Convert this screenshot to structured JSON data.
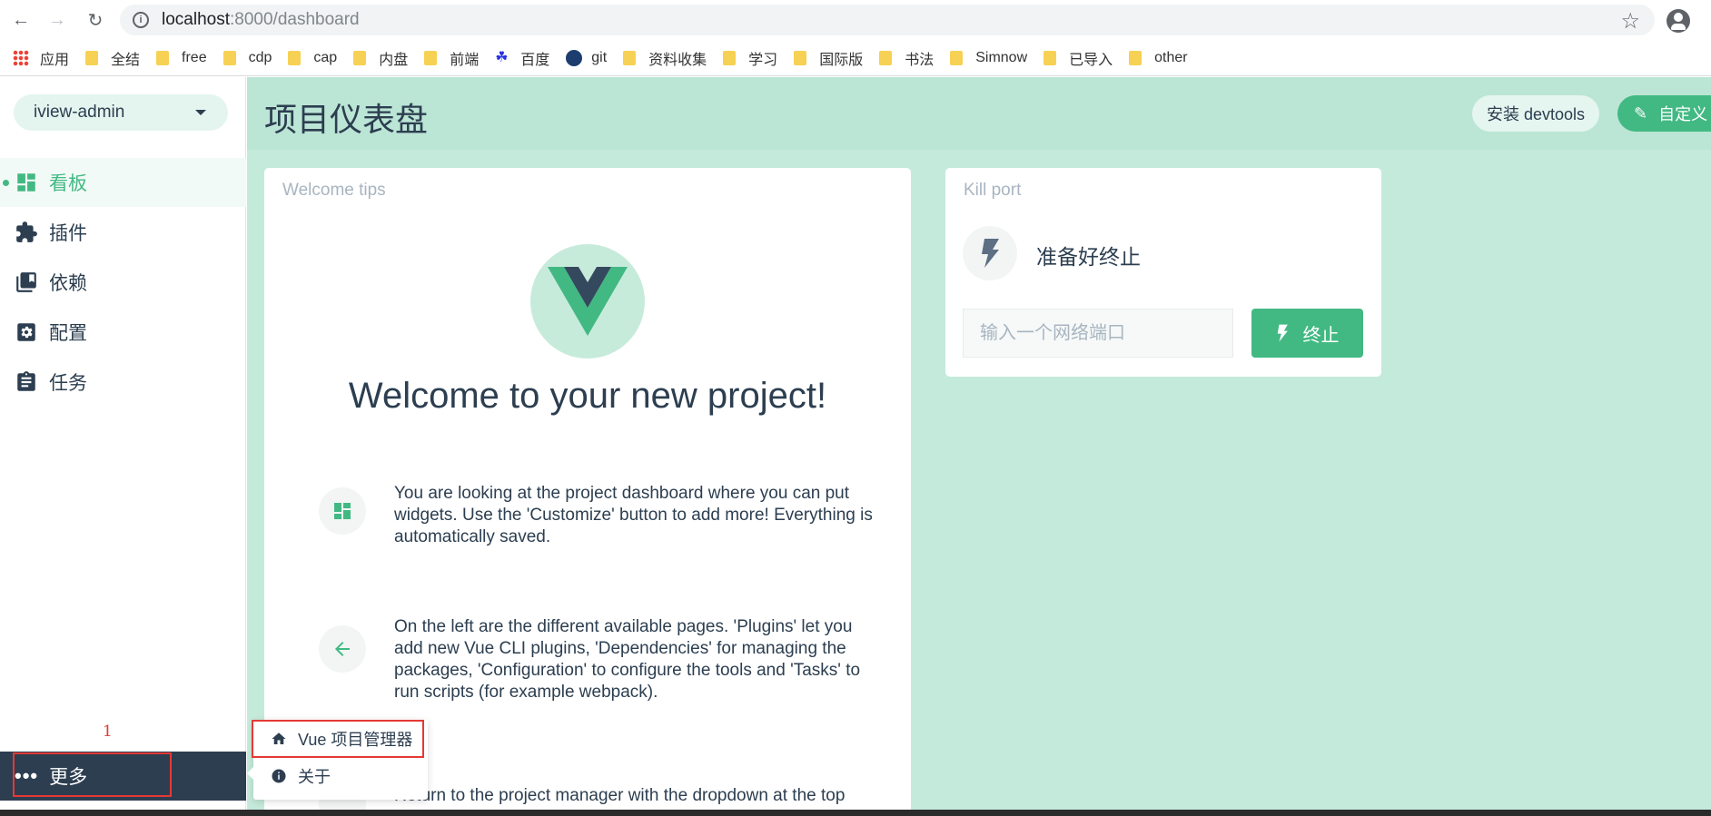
{
  "browser": {
    "url_host": "localhost",
    "url_path": ":8000/dashboard",
    "bookmarks": [
      {
        "label": "应用",
        "kind": "apps"
      },
      {
        "label": "全结",
        "kind": "folder"
      },
      {
        "label": "free",
        "kind": "folder"
      },
      {
        "label": "cdp",
        "kind": "folder"
      },
      {
        "label": "cap",
        "kind": "folder"
      },
      {
        "label": "内盘",
        "kind": "folder"
      },
      {
        "label": "前端",
        "kind": "folder"
      },
      {
        "label": "百度",
        "kind": "baidu"
      },
      {
        "label": "git",
        "kind": "git"
      },
      {
        "label": "资料收集",
        "kind": "folder"
      },
      {
        "label": "学习",
        "kind": "folder"
      },
      {
        "label": "国际版",
        "kind": "folder"
      },
      {
        "label": "书法",
        "kind": "folder"
      },
      {
        "label": "Simnow",
        "kind": "folder"
      },
      {
        "label": "已导入",
        "kind": "folder"
      },
      {
        "label": "other",
        "kind": "folder"
      }
    ]
  },
  "sidebar": {
    "project": "iview-admin",
    "items": [
      {
        "label": "看板",
        "icon": "dashboard-icon",
        "active": true
      },
      {
        "label": "插件",
        "icon": "puzzle-icon",
        "active": false
      },
      {
        "label": "依赖",
        "icon": "library-icon",
        "active": false
      },
      {
        "label": "配置",
        "icon": "settings-icon",
        "active": false
      },
      {
        "label": "任务",
        "icon": "assignment-icon",
        "active": false
      }
    ],
    "more_label": "更多"
  },
  "header": {
    "title": "项目仪表盘",
    "devtools_label": "安装 devtools",
    "customize_label": "自定义"
  },
  "welcome": {
    "card_title": "Welcome tips",
    "heading": "Welcome to your new project!",
    "tips": [
      "You are looking at the project dashboard where you can put widgets. Use the 'Customize' button to add more! Everything is automatically saved.",
      "On the left are the different available pages. 'Plugins' let you add new Vue CLI plugins, 'Dependencies' for managing the packages, 'Configuration' to configure the tools and 'Tasks' to run scripts (for example webpack).",
      "Return to the project manager with the dropdown at the top"
    ]
  },
  "kill_port": {
    "card_title": "Kill port",
    "status": "准备好终止",
    "input_placeholder": "输入一个网络端口",
    "button_label": "终止"
  },
  "dropdown": {
    "items": [
      {
        "label": "Vue 项目管理器",
        "icon": "home-icon"
      },
      {
        "label": "关于",
        "icon": "info-icon"
      }
    ]
  },
  "annotation": {
    "number": "1"
  },
  "colors": {
    "accent": "#42b983",
    "dark": "#2c3e50",
    "main_bg": "#c4eadb",
    "annotation": "#e53935"
  }
}
